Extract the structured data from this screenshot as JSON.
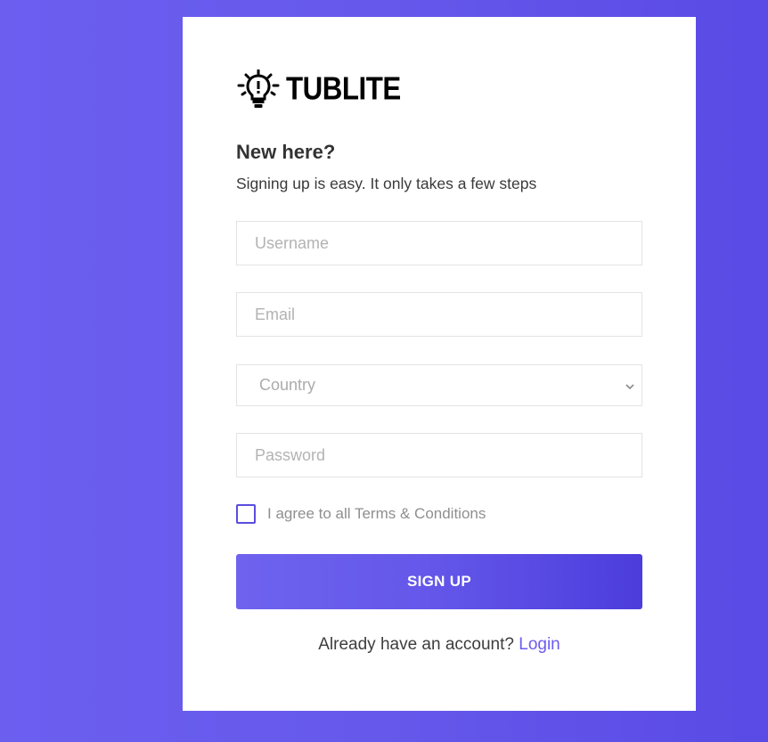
{
  "brand": {
    "name": "TUBLITE",
    "icon": "lightbulb-icon"
  },
  "form": {
    "title": "New here?",
    "subtitle": "Signing up is easy. It only takes a few steps",
    "username_placeholder": "Username",
    "email_placeholder": "Email",
    "country_placeholder": "Country",
    "password_placeholder": "Password",
    "agree_label": "I agree to all Terms & Conditions",
    "agree_checked": false,
    "signup_label": "SIGN UP",
    "footer_text": "Already have an account?",
    "login_link": "Login"
  },
  "colors": {
    "accent": "#6558ea",
    "link": "#6b5cf0",
    "background": "#6558ea"
  }
}
